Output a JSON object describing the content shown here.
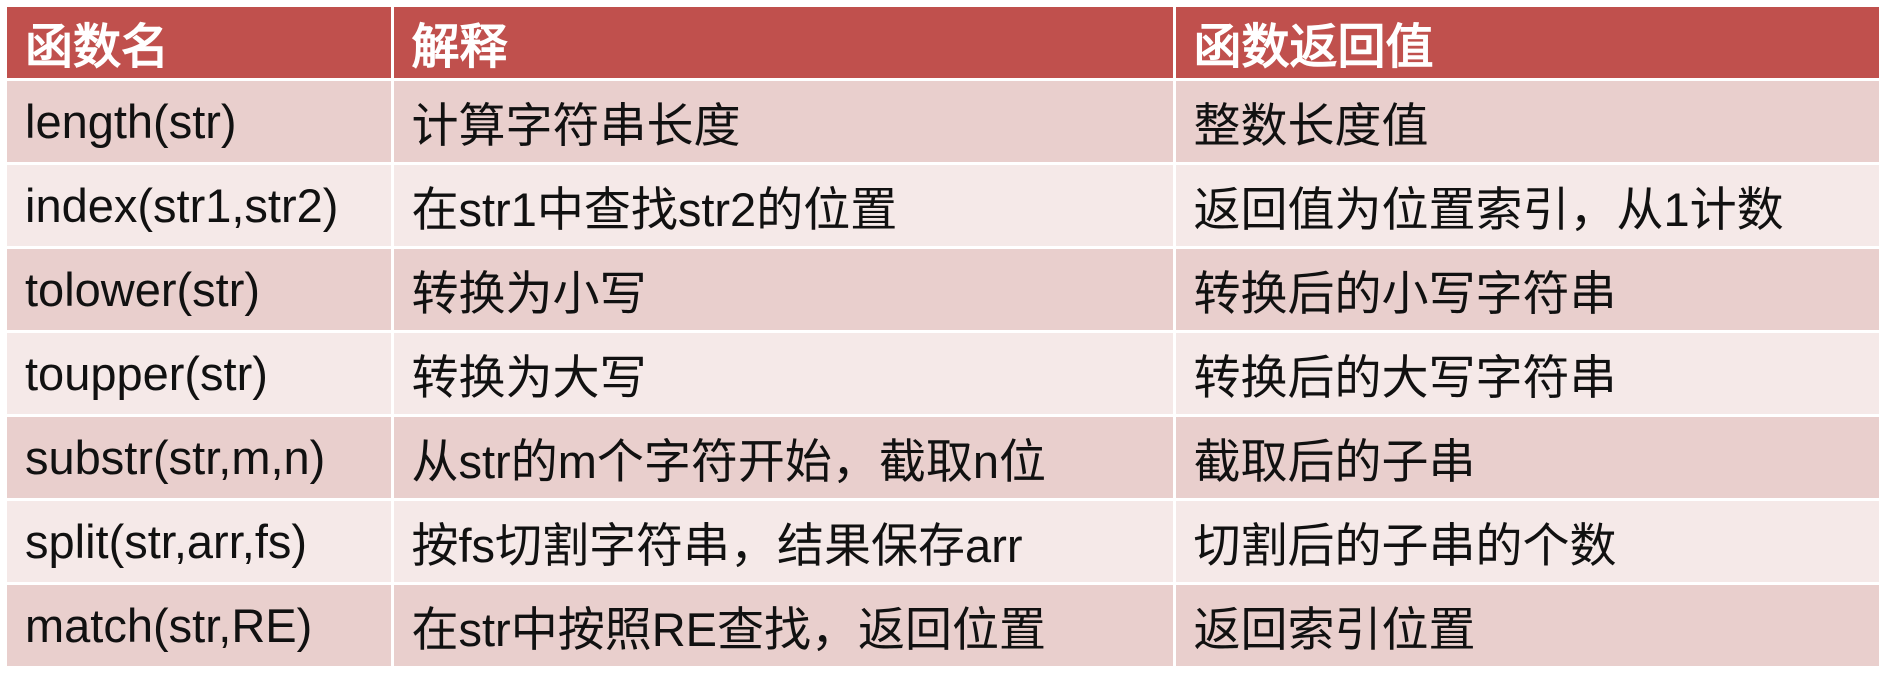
{
  "table": {
    "headers": [
      "函数名",
      "解释",
      "函数返回值"
    ],
    "rows": [
      [
        "length(str)",
        "计算字符串长度",
        "整数长度值"
      ],
      [
        "index(str1,str2)",
        "在str1中查找str2的位置",
        "返回值为位置索引，从1计数"
      ],
      [
        "tolower(str)",
        "转换为小写",
        "转换后的小写字符串"
      ],
      [
        "toupper(str)",
        "转换为大写",
        "转换后的大写字符串"
      ],
      [
        "substr(str,m,n)",
        "从str的m个字符开始，截取n位",
        "截取后的子串"
      ],
      [
        "split(str,arr,fs)",
        "按fs切割字符串，结果保存arr",
        "切割后的子串的个数"
      ],
      [
        "match(str,RE)",
        "在str中按照RE查找，返回位置",
        "返回索引位置"
      ]
    ]
  },
  "colors": {
    "header_bg": "#c0504d",
    "row_odd_bg": "#e9cfcd",
    "row_even_bg": "#f5e9e8"
  }
}
